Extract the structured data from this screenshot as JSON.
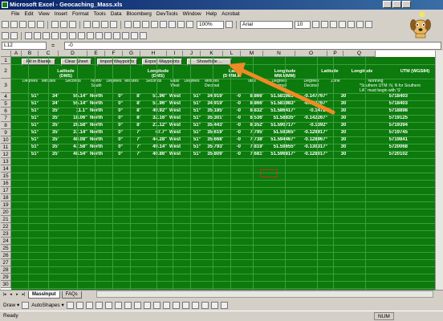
{
  "window": {
    "title": "Microsoft Excel - Geocaching_Mass.xls"
  },
  "menu": [
    "File",
    "Edit",
    "View",
    "Insert",
    "Format",
    "Tools",
    "Data",
    "Bloomberg",
    "DevTools",
    "Window",
    "Help",
    "Acrobat"
  ],
  "toolbar": {
    "zoom": "100%",
    "font": "Arial",
    "font_size": "10"
  },
  "formula_bar": {
    "cell_ref": "L12",
    "fx": "=",
    "value": "-0"
  },
  "columns": [
    "A",
    "B",
    "C",
    "D",
    "E",
    "F",
    "G",
    "H",
    "I",
    "J",
    "K",
    "L",
    "M",
    "N",
    "O",
    "P",
    "Q"
  ],
  "rows": [
    "1",
    "2",
    "3",
    "4",
    "5",
    "6",
    "7",
    "8",
    "9",
    "10",
    "11",
    "12",
    "13",
    "14",
    "15",
    "16",
    "17",
    "18",
    "19",
    "20",
    "21",
    "22",
    "23",
    "24",
    "25",
    "26",
    "27",
    "28",
    "29",
    "30"
  ],
  "buttons": [
    "Fill in Blanks",
    "Clear Sheet",
    "Import Waypoints",
    "Export Waypoints",
    "Show/hide ..."
  ],
  "headers": {
    "lat_dms": "Latitude\n(DMS)",
    "lon_dms": "Longitude\n(DMS)",
    "lat_dmm": "Lat\n(D MM.M",
    "lon_dmm": "Longitude\nMM.MMM)",
    "lat_dec": "Latitude",
    "lon_dec": "Longitude",
    "utm": "UTM (WGS84)"
  },
  "subheaders": {
    "c1": "Degrees",
    "c2": "Minutes",
    "c3": "Seconds",
    "c4": "North/\nSouth",
    "c5": "Degrees",
    "c6": "Minutes",
    "c7": "Seconds",
    "c8": "East/\nWest",
    "c9": "Degrees",
    "c10": "Minutes\nDecimal",
    "c11": "",
    "c12": "utes",
    "c13": "Degrees\nDecimal",
    "c14": "Degrees\nDecimal",
    "c15": "Zone",
    "c16": "Northing\n*Southern UTM: N, N for Southern\nLAT must begin with 'S'"
  },
  "data_rows": [
    [
      "51°",
      "34'",
      "55.14\"",
      "North",
      "0°",
      "8'",
      "51.96\"",
      "West",
      "51°",
      "34.919'",
      "-0",
      "8.866'",
      "51.581983°",
      "-0.147767°",
      "30",
      "5718403"
    ],
    [
      "51°",
      "34'",
      "55.14\"",
      "North",
      "0°",
      "8'",
      "51.96\"",
      "West",
      "51°",
      "34.919'",
      "-0",
      "8.866'",
      "51.581983°",
      "-0.147767°",
      "30",
      "5718403"
    ],
    [
      "51°",
      "35'",
      "11.1\"",
      "North",
      "0°",
      "8'",
      "49.92\"",
      "West",
      "51°",
      "35.185'",
      "-0",
      "8.832'",
      "51.586417°",
      "-0.1472°",
      "30",
      "5718898"
    ],
    [
      "51°",
      "35'",
      "18.06\"",
      "North",
      "0°",
      "8'",
      "32.16\"",
      "West",
      "51°",
      "35.301'",
      "-0",
      "8.536'",
      "51.58835°",
      "-0.142267°",
      "30",
      "5719125"
    ],
    [
      "51°",
      "35'",
      "26.58\"",
      "North",
      "0°",
      "8'",
      "21.12\"",
      "West",
      "51°",
      "35.443'",
      "-0",
      "8.352'",
      "51.590717°",
      "-0.1392°",
      "30",
      "5719394"
    ],
    [
      "51°",
      "35'",
      "37.14\"",
      "North",
      "0°",
      "7'",
      "47.7\"",
      "West",
      "51°",
      "35.619'",
      "-0",
      "7.795'",
      "51.59365°",
      "-0.129917°",
      "30",
      "5719745"
    ],
    [
      "51°",
      "35'",
      "40.08\"",
      "North",
      "0°",
      "7'",
      "44.28\"",
      "West",
      "51°",
      "35.668'",
      "-0",
      "7.738'",
      "51.594467°",
      "-0.128967°",
      "30",
      "5719841"
    ],
    [
      "51°",
      "35'",
      "47.58\"",
      "North",
      "0°",
      "7'",
      "49.14\"",
      "West",
      "51°",
      "35.793'",
      "-0",
      "7.819'",
      "51.59655°",
      "-0.130317°",
      "30",
      "5720068"
    ],
    [
      "51°",
      "35'",
      "48.54\"",
      "North",
      "0°",
      "7'",
      "40.86\"",
      "West",
      "51°",
      "35.809'",
      "-0",
      "7.681'",
      "51.596817°",
      "-0.128017°",
      "30",
      "5720102"
    ]
  ],
  "sheet_tabs": [
    "MassInput",
    "FAQs"
  ],
  "active_tab": "MassInput",
  "drawbar": {
    "draw": "Draw ▾",
    "autoshapes": "AutoShapes ▾"
  },
  "status": {
    "left": "Ready",
    "num": "NUM"
  },
  "colors": {
    "sheet_green": "#0c7a0c",
    "arrow": "#f08a24",
    "title_blue": "#0a246a"
  }
}
